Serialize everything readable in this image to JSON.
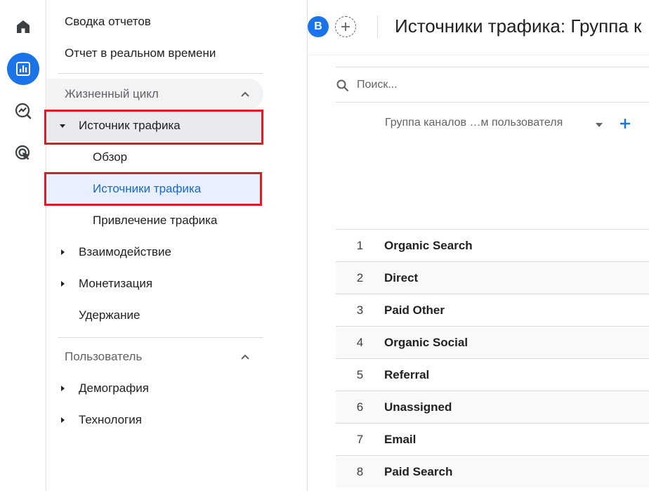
{
  "sidebar": {
    "reports_snapshot": "Сводка отчетов",
    "realtime": "Отчет в реальном времени",
    "sections": [
      {
        "label": "Жизненный цикл",
        "items": [
          {
            "label": "Источник трафика"
          },
          {
            "label": "Обзор"
          },
          {
            "label": "Источники трафика"
          },
          {
            "label": "Привлечение трафика"
          },
          {
            "label": "Взаимодействие"
          },
          {
            "label": "Монетизация"
          },
          {
            "label": "Удержание"
          }
        ]
      },
      {
        "label": "Пользователь",
        "items": [
          {
            "label": "Демография"
          },
          {
            "label": "Технология"
          }
        ]
      }
    ]
  },
  "header": {
    "avatar_letter": "B",
    "title": "Источники трафика: Группа к"
  },
  "table": {
    "search_placeholder": "Поиск...",
    "dimension_label": "Группа каналов …м пользователя",
    "rows": [
      {
        "index": "1",
        "name": "Organic Search"
      },
      {
        "index": "2",
        "name": "Direct"
      },
      {
        "index": "3",
        "name": "Paid Other"
      },
      {
        "index": "4",
        "name": "Organic Social"
      },
      {
        "index": "5",
        "name": "Referral"
      },
      {
        "index": "6",
        "name": "Unassigned"
      },
      {
        "index": "7",
        "name": "Email"
      },
      {
        "index": "8",
        "name": "Paid Search"
      }
    ]
  },
  "colors": {
    "accent": "#1a73e8",
    "highlight": "#e01b24",
    "active_text": "#1967d2"
  }
}
